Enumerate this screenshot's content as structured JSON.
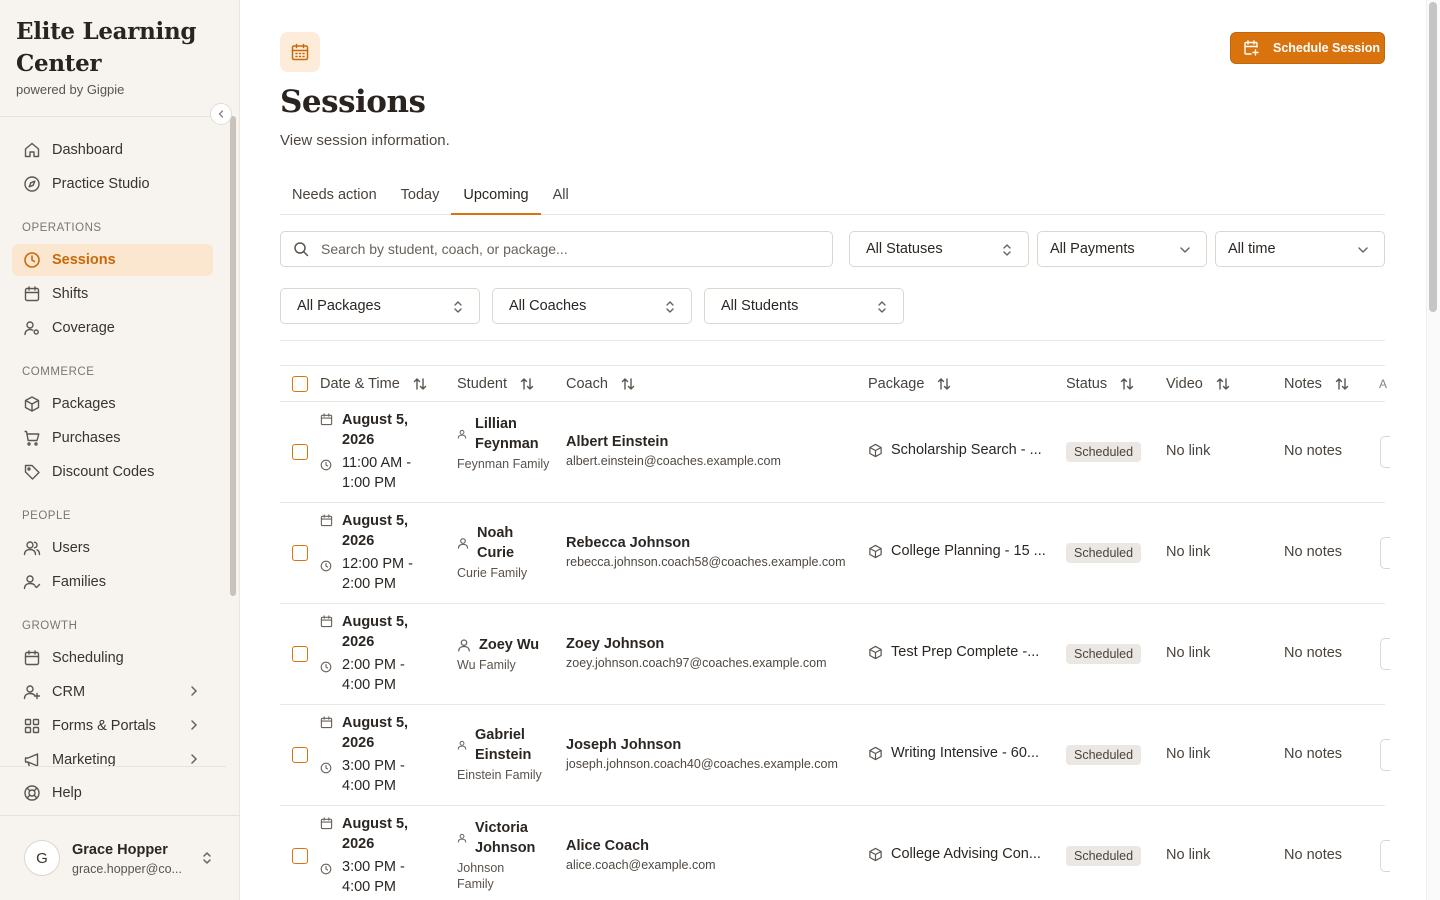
{
  "app": {
    "brand_title": "Elite Learning Center",
    "brand_subtitle": "powered by Gigpie"
  },
  "sidebar": {
    "top_items": [
      {
        "label": "Dashboard",
        "icon": "home-icon"
      },
      {
        "label": "Practice Studio",
        "icon": "compass-icon"
      }
    ],
    "sections": [
      {
        "title": "OPERATIONS",
        "items": [
          {
            "label": "Sessions",
            "icon": "clock-icon",
            "active": true
          },
          {
            "label": "Shifts",
            "icon": "calendar-icon"
          },
          {
            "label": "Coverage",
            "icon": "user-cog-icon"
          }
        ]
      },
      {
        "title": "COMMERCE",
        "items": [
          {
            "label": "Packages",
            "icon": "package-icon"
          },
          {
            "label": "Purchases",
            "icon": "cart-icon"
          },
          {
            "label": "Discount Codes",
            "icon": "tag-icon"
          }
        ]
      },
      {
        "title": "PEOPLE",
        "items": [
          {
            "label": "Users",
            "icon": "users-icon"
          },
          {
            "label": "Families",
            "icon": "user-check-icon"
          }
        ]
      },
      {
        "title": "GROWTH",
        "items": [
          {
            "label": "Scheduling",
            "icon": "calendar-icon"
          },
          {
            "label": "CRM",
            "icon": "user-plus-icon",
            "expandable": true
          },
          {
            "label": "Forms & Portals",
            "icon": "grid-icon",
            "expandable": true
          },
          {
            "label": "Marketing",
            "icon": "megaphone-icon",
            "expandable": true
          }
        ]
      }
    ],
    "help_label": "Help",
    "user": {
      "initial": "G",
      "name": "Grace Hopper",
      "email": "grace.hopper@co..."
    }
  },
  "header": {
    "title": "Sessions",
    "subtitle": "View session information.",
    "schedule_button": "Schedule Session"
  },
  "tabs": [
    {
      "label": "Needs action",
      "active": false
    },
    {
      "label": "Today",
      "active": false
    },
    {
      "label": "Upcoming",
      "active": true
    },
    {
      "label": "All",
      "active": false
    }
  ],
  "filters": {
    "search_placeholder": "Search by student, coach, or package...",
    "status": "All Statuses",
    "payments": "All Payments",
    "time": "All time",
    "packages": "All Packages",
    "coaches": "All Coaches",
    "students": "All Students"
  },
  "table": {
    "columns": [
      "Date & Time",
      "Student",
      "Coach",
      "Package",
      "Status",
      "Video",
      "Notes",
      "A"
    ],
    "rows": [
      {
        "date": "August 5, 2026",
        "time": "11:00 AM - 1:00 PM",
        "student": "Lillian Feynman",
        "family": "Feynman Family",
        "coach": "Albert Einstein",
        "coach_email": "albert.einstein@coaches.example.com",
        "package": "Scholarship Search - ...",
        "status": "Scheduled",
        "video": "No link",
        "notes": "No notes"
      },
      {
        "date": "August 5, 2026",
        "time": "12:00 PM - 2:00 PM",
        "student": "Noah Curie",
        "family": "Curie Family",
        "coach": "Rebecca Johnson",
        "coach_email": "rebecca.johnson.coach58@coaches.example.com",
        "package": "College Planning - 15 ...",
        "status": "Scheduled",
        "video": "No link",
        "notes": "No notes"
      },
      {
        "date": "August 5, 2026",
        "time": "2:00 PM - 4:00 PM",
        "student": "Zoey Wu",
        "family": "Wu Family",
        "coach": "Zoey Johnson",
        "coach_email": "zoey.johnson.coach97@coaches.example.com",
        "package": "Test Prep Complete -...",
        "status": "Scheduled",
        "video": "No link",
        "notes": "No notes"
      },
      {
        "date": "August 5, 2026",
        "time": "3:00 PM - 4:00 PM",
        "student": "Gabriel Einstein",
        "family": "Einstein Family",
        "coach": "Joseph Johnson",
        "coach_email": "joseph.johnson.coach40@coaches.example.com",
        "package": "Writing Intensive - 60...",
        "status": "Scheduled",
        "video": "No link",
        "notes": "No notes"
      },
      {
        "date": "August 5, 2026",
        "time": "3:00 PM - 4:00 PM",
        "student": "Victoria Johnson",
        "family": "Johnson Family",
        "coach": "Alice Coach",
        "coach_email": "alice.coach@example.com",
        "package": "College Advising Con...",
        "status": "Scheduled",
        "video": "No link",
        "notes": "No notes"
      }
    ]
  },
  "colors": {
    "accent": "#d9730d",
    "active_nav_bg": "#fbe6cf",
    "sidebar_bg": "#f7f4ef"
  }
}
